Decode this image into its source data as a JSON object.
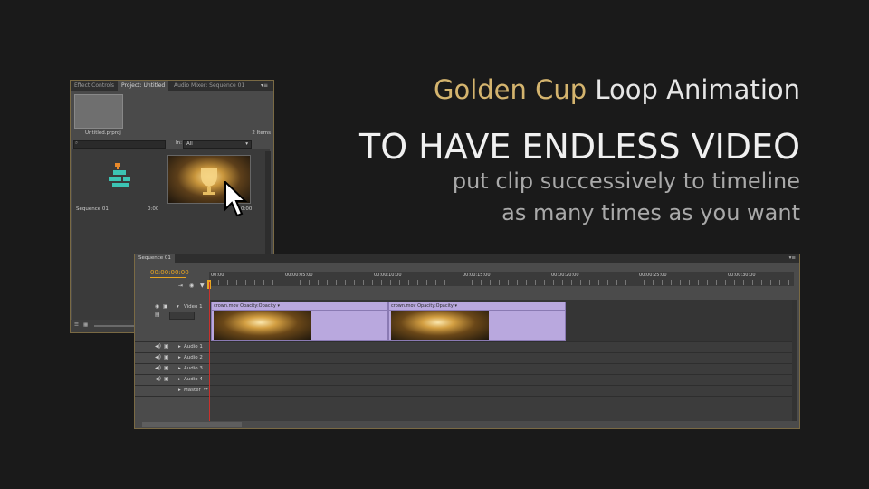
{
  "promo": {
    "title_gold": "Golden Cup",
    "title_rest": "Loop Animation",
    "headline": "TO HAVE ENDLESS VIDEO",
    "sub_line1": "put clip successively to timeline",
    "sub_line2": "as many times as you want"
  },
  "project_panel": {
    "tabs": [
      "Effect Controls",
      "Project: Untitled",
      "Audio Mixer: Sequence 01"
    ],
    "active_tab": "Project: Untitled",
    "project_file": "Untitled.prproj",
    "item_count": "2 Items",
    "in_label": "In:",
    "in_value": "All",
    "items": [
      {
        "name": "Sequence 01",
        "duration": "0:00"
      },
      {
        "name": "",
        "duration": "0:00"
      }
    ]
  },
  "timeline": {
    "tab": "Sequence 01",
    "timecode": "00:00:00:00",
    "ruler_labels": [
      "00:00",
      "00:00:05:00",
      "00:00:10:00",
      "00:00:15:00",
      "00:00:20:00",
      "00:00:25:00",
      "00:00:30:00"
    ],
    "video_track": "Video 1",
    "audio_tracks": [
      "Audio 1",
      "Audio 2",
      "Audio 3",
      "Audio 4"
    ],
    "master": "Master",
    "clips": [
      {
        "name": "crown.mov",
        "effect": "Opacity:Opacity"
      },
      {
        "name": "crown.mov",
        "effect": "Opacity:Opacity"
      }
    ]
  },
  "colors": {
    "background": "#1a1a1a",
    "gold_text": "#d4b46e",
    "timecode": "#e8a521",
    "clip": "#b9a8de",
    "playhead": "#c9302c"
  }
}
